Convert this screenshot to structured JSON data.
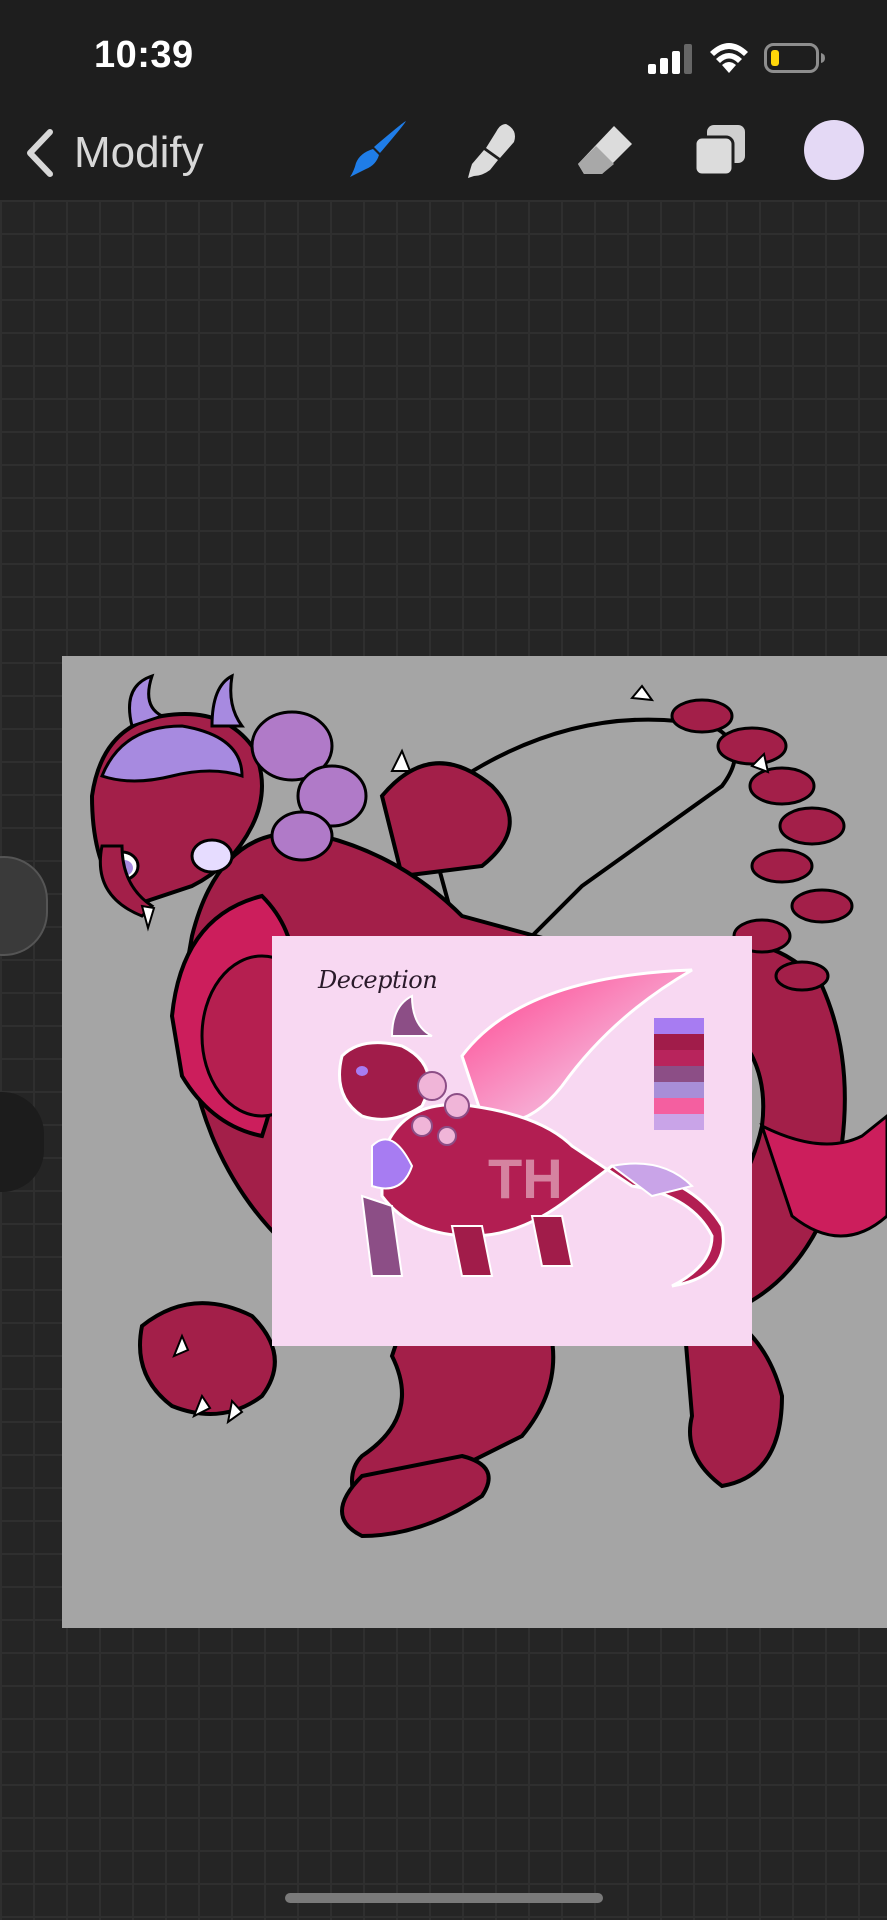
{
  "status_bar": {
    "time": "10:39",
    "battery_color": "#ffd60a"
  },
  "toolbar": {
    "back_label": "Modify",
    "tools": [
      {
        "name": "brush-icon",
        "active": true,
        "color": "#1f7de8"
      },
      {
        "name": "smudge-icon",
        "active": false
      },
      {
        "name": "eraser-icon",
        "active": false
      },
      {
        "name": "layers-icon",
        "active": false
      },
      {
        "name": "color-swatch",
        "color": "#e4d9f5"
      }
    ]
  },
  "reference_sheet": {
    "title": "Deception",
    "watermark": "TH",
    "palette": [
      "#a77cf2",
      "#a11c4a",
      "#b8245c",
      "#8c4e86",
      "#a88ed8",
      "#f45fa0",
      "#c9a4e8"
    ]
  },
  "colors": {
    "background": "#252525",
    "canvas": "#a5a5a5",
    "dragon_main": "#a31f49",
    "dragon_bright": "#cc1e5c",
    "accent_purple": "#a78ae0"
  }
}
